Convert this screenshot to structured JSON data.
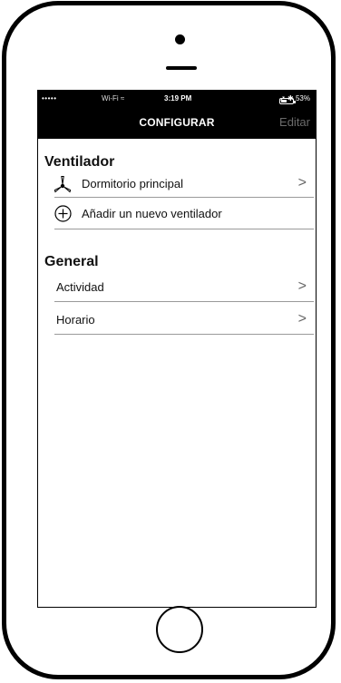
{
  "status_bar": {
    "signal": "•••••",
    "wifi": "Wi-Fi ≈",
    "time": "3:19 PM",
    "battery_text": "➚ ✱ 53%",
    "battery_level": 0.53
  },
  "nav": {
    "title": "CONFIGURAR",
    "edit_label": "Editar"
  },
  "fans_section": {
    "title": "Ventilador",
    "items": [
      {
        "label": "Dormitorio principal",
        "icon": "fan-icon"
      }
    ],
    "add_label": "Añadir un nuevo ventilador"
  },
  "general_section": {
    "title": "General",
    "items": [
      {
        "label": "Actividad"
      },
      {
        "label": "Horario"
      }
    ]
  },
  "colors": {
    "bar_background": "#000000",
    "edit_text": "#6b6b6b",
    "divider": "#9a9a9a"
  }
}
